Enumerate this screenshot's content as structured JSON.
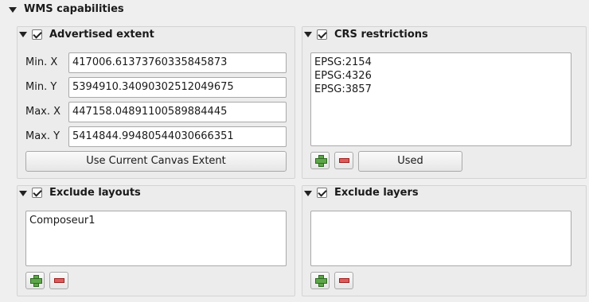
{
  "wms": {
    "title": "WMS capabilities"
  },
  "advertised_extent": {
    "title": "Advertised extent",
    "checked": true,
    "fields": [
      {
        "label": "Min. X",
        "value": "417006.61373760335845873"
      },
      {
        "label": "Min. Y",
        "value": "5394910.34090302512049675"
      },
      {
        "label": "Max. X",
        "value": "447158.04891100589884445"
      },
      {
        "label": "Max. Y",
        "value": "5414844.99480544030666351"
      }
    ],
    "canvas_button": "Use Current Canvas Extent"
  },
  "crs_restrictions": {
    "title": "CRS restrictions",
    "checked": true,
    "items": [
      "EPSG:2154",
      "EPSG:4326",
      "EPSG:3857"
    ],
    "used_button": "Used"
  },
  "exclude_layouts": {
    "title": "Exclude layouts",
    "checked": true,
    "items": [
      "Composeur1"
    ]
  },
  "exclude_layers": {
    "title": "Exclude layers",
    "checked": true,
    "items": []
  },
  "colors": {
    "add": "#5ea64a",
    "remove": "#e05a5a"
  }
}
